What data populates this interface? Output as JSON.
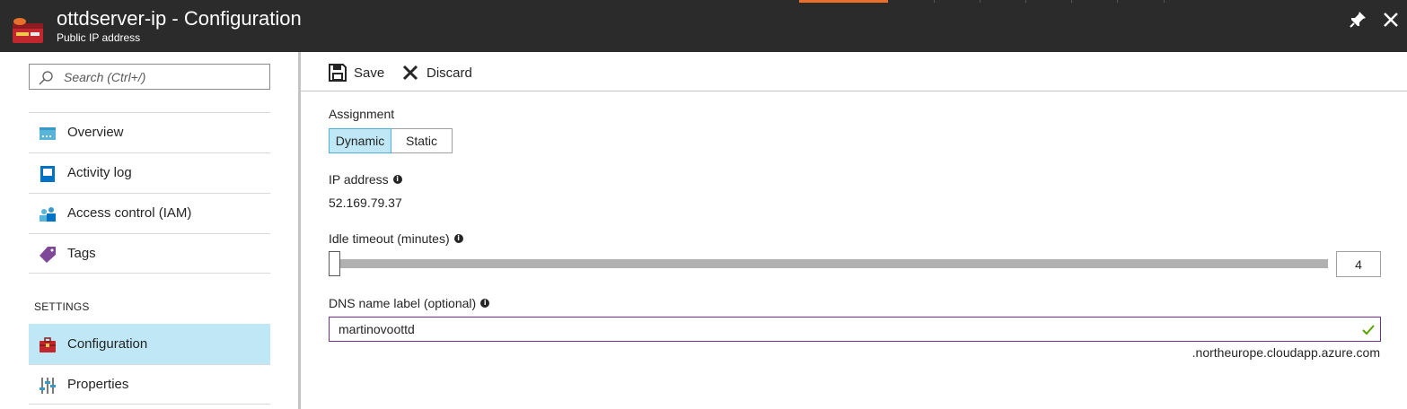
{
  "header": {
    "title": "ottdserver-ip - Configuration",
    "subtitle": "Public IP address",
    "accent_color": "#e8702a",
    "background_color": "#2b2b2b",
    "icons": [
      "public-ip-icon",
      "pin-icon",
      "close-icon"
    ]
  },
  "sidebar": {
    "search_placeholder": "Search (Ctrl+/)",
    "items": [
      {
        "label": "Overview",
        "icon": "overview-icon"
      },
      {
        "label": "Activity log",
        "icon": "activity-log-icon"
      },
      {
        "label": "Access control (IAM)",
        "icon": "iam-icon"
      },
      {
        "label": "Tags",
        "icon": "tag-icon"
      }
    ],
    "section_label": "SETTINGS",
    "settings_items": [
      {
        "label": "Configuration",
        "icon": "configuration-icon",
        "active": true
      },
      {
        "label": "Properties",
        "icon": "properties-icon",
        "active": false
      }
    ],
    "active_color": "#bfe7f5"
  },
  "toolbar": {
    "save_label": "Save",
    "discard_label": "Discard"
  },
  "form": {
    "assignment": {
      "label": "Assignment",
      "options": [
        "Dynamic",
        "Static"
      ],
      "selected": "Dynamic"
    },
    "ip_address": {
      "label": "IP address",
      "value": "52.169.79.37"
    },
    "idle_timeout": {
      "label": "Idle timeout (minutes)",
      "value": "4",
      "min": 4,
      "max": 30
    },
    "dns_label": {
      "label": "DNS name label (optional)",
      "value": "martinovoottd",
      "valid": true,
      "suffix": ".northeurope.cloudapp.azure.com",
      "border_color": "#6f2c91",
      "check_color": "#57a300"
    }
  }
}
